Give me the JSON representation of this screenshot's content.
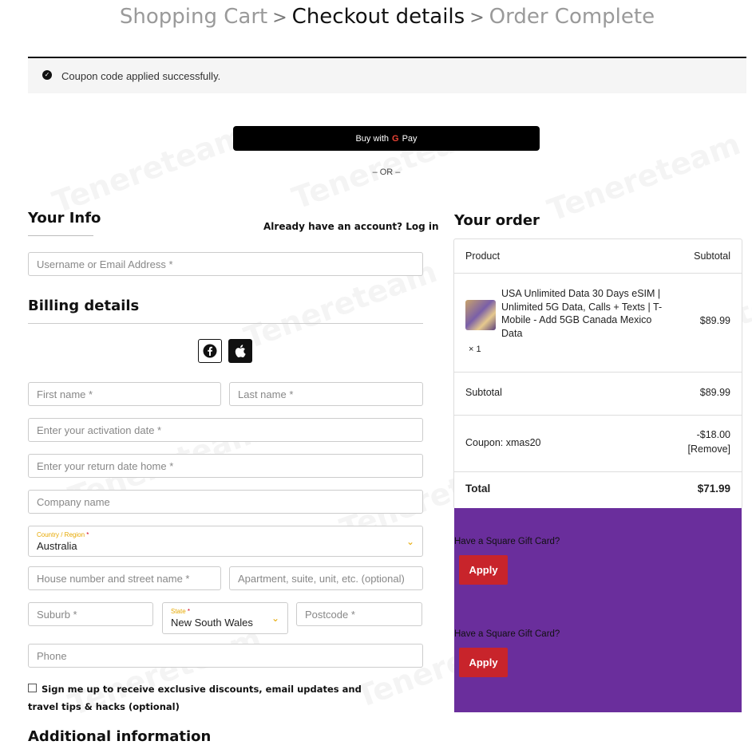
{
  "steps": {
    "step1": "Shopping Cart",
    "sep": ">",
    "step2": "Checkout details",
    "step3": "Order Complete"
  },
  "notice": {
    "text": "Coupon code applied successfully."
  },
  "gpay": {
    "prefix": "Buy with",
    "g": "G",
    "pay": "Pay"
  },
  "or_divider": "– OR –",
  "your_info": {
    "title": "Your Info",
    "login_text": "Already have an account? Log in",
    "username_placeholder": "Username or Email Address *"
  },
  "billing": {
    "title": "Billing details",
    "first_name": "First name *",
    "last_name": "Last name *",
    "activation_date": "Enter your activation date *",
    "return_date": "Enter your return date home *",
    "company": "Company name",
    "country_label": "Country / Region",
    "required_mark": "*",
    "country_value": "Australia",
    "street": "House number and street name *",
    "apartment": "Apartment, suite, unit, etc. (optional)",
    "suburb": "Suburb *",
    "state_label": "State",
    "state_value": "New South Wales",
    "postcode": "Postcode *",
    "phone": "Phone",
    "signup_text": "Sign me up to receive exclusive discounts, email updates and travel tips & hacks (optional)"
  },
  "additional_info": {
    "title": "Additional information"
  },
  "order": {
    "title": "Your order",
    "col_product": "Product",
    "col_subtotal": "Subtotal",
    "product_name": "USA Unlimited Data 30 Days eSIM | Unlimited 5G Data, Calls + Texts | T-Mobile - Add 5GB Canada Mexico Data",
    "product_qty": "× 1",
    "product_price": "$89.99",
    "subtotal_label": "Subtotal",
    "subtotal_value": "$89.99",
    "coupon_label": "Coupon: xmas20",
    "coupon_value": "-$18.00",
    "coupon_remove": "[Remove]",
    "total_label": "Total",
    "total_value": "$71.99"
  },
  "gift_cards": [
    {
      "text": "Have a Square Gift Card?",
      "button": "Apply"
    },
    {
      "text": "Have a Square Gift Card?",
      "button": "Apply"
    }
  ],
  "watermark": "Tenereteam",
  "colors": {
    "accent_yellow": "#e6a800",
    "apply_red": "#c8242b",
    "gift_purple": "#6a2e9c"
  }
}
